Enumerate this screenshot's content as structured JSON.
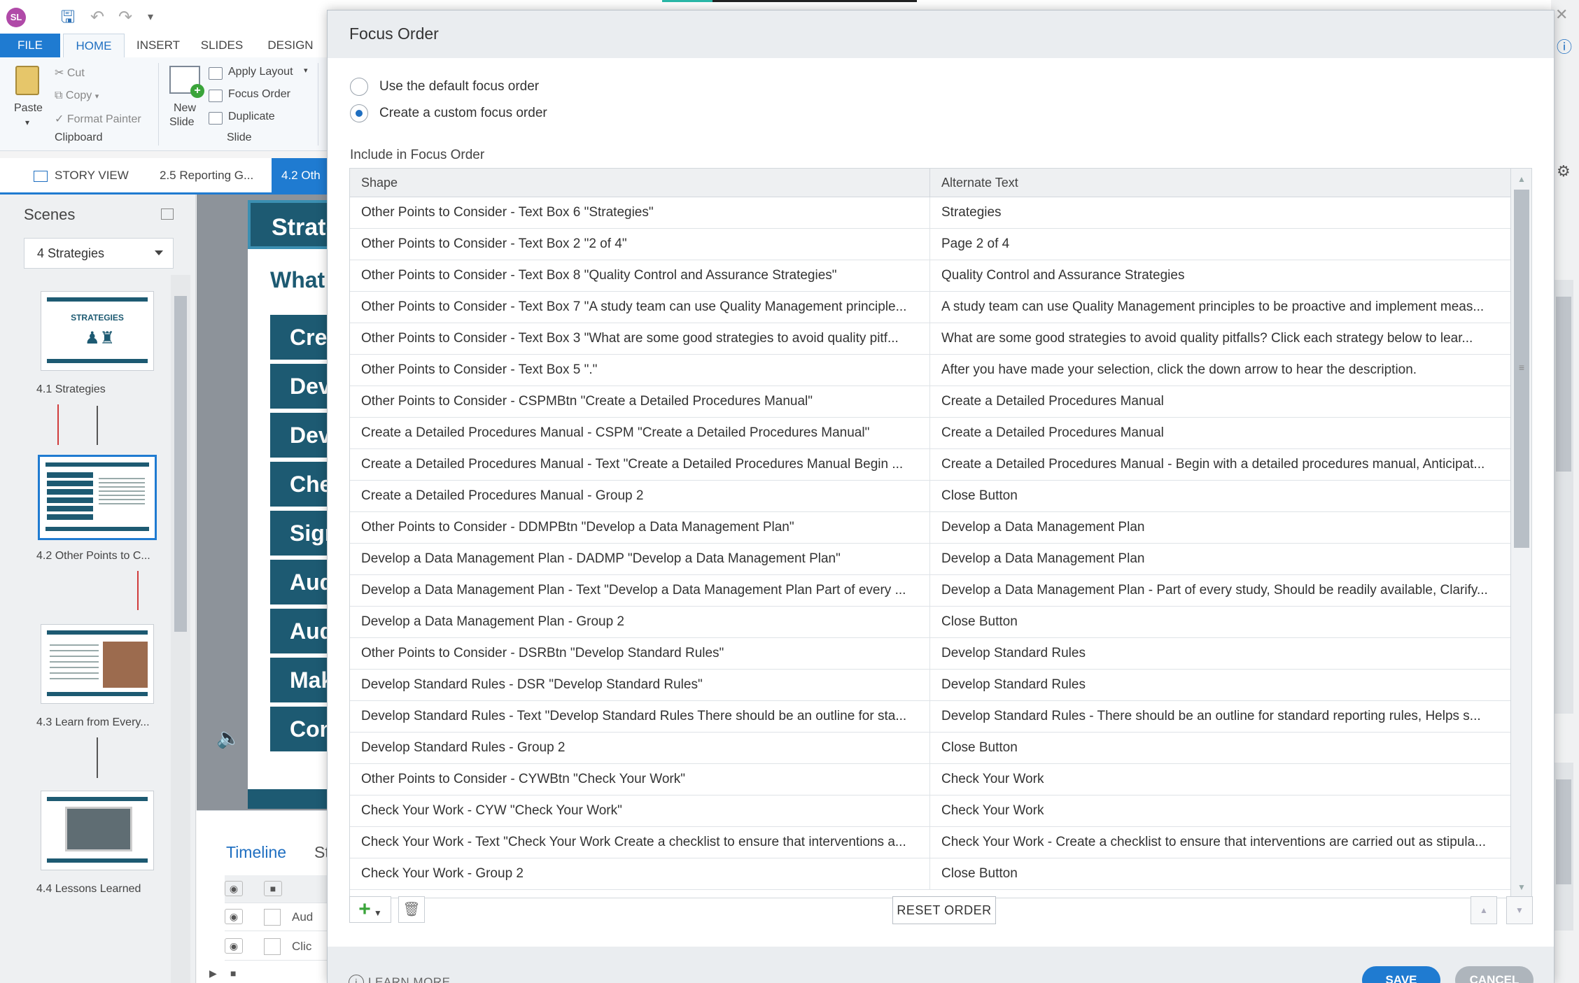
{
  "app": {
    "logo": "SL",
    "ribbon_tabs": [
      "FILE",
      "HOME",
      "INSERT",
      "SLIDES",
      "DESIGN"
    ],
    "clipboard": {
      "paste": "Paste",
      "cut": "Cut",
      "copy": "Copy",
      "format_painter": "Format Painter",
      "group": "Clipboard"
    },
    "slide_group": {
      "new_slide": "New",
      "new_slide2": "Slide",
      "apply_layout": "Apply Layout",
      "focus_order": "Focus Order",
      "duplicate": "Duplicate",
      "group": "Slide"
    },
    "view_tabs": {
      "story_view": "STORY VIEW",
      "tab2": "2.5 Reporting G...",
      "tab3": "4.2 Oth"
    }
  },
  "scenes": {
    "title": "Scenes",
    "dropdown": "4 Strategies",
    "thumbs": [
      {
        "label": "4.1 Strategies",
        "text": "STRATEGIES"
      },
      {
        "label": "4.2 Other Points to C..."
      },
      {
        "label": "4.3 Learn from Every..."
      },
      {
        "label": "4.4 Lessons Learned"
      }
    ]
  },
  "slide": {
    "title": "Strate",
    "question": "What",
    "buttons": [
      "Crea",
      "Dev",
      "Dev",
      "Che",
      "Sign",
      "Aud",
      "Aud",
      "Mak",
      "Con"
    ]
  },
  "timeline": {
    "tab": "Timeline",
    "tab2": "St",
    "rows": [
      "Aud",
      "Clic"
    ]
  },
  "dialog": {
    "title": "Focus Order",
    "radio_default": "Use the default focus order",
    "radio_custom": "Create a custom focus order",
    "selected": "custom",
    "include_label": "Include in Focus Order",
    "columns": [
      "Shape",
      "Alternate Text"
    ],
    "rows": [
      [
        "Other Points to Consider - Text Box 6 \"Strategies\"",
        "Strategies"
      ],
      [
        "Other Points to Consider - Text Box 2 \"2 of 4\"",
        "Page 2 of 4"
      ],
      [
        "Other Points to Consider - Text Box 8 \"Quality Control and Assurance Strategies\"",
        "Quality Control and Assurance Strategies"
      ],
      [
        "Other Points to Consider - Text Box 7 \"A study team can use Quality Management principle...",
        "A study team can use Quality Management principles to be proactive and implement meas..."
      ],
      [
        "Other Points to Consider - Text Box 3 \"What are some good strategies to avoid quality pitf...",
        "What are some good strategies to avoid quality pitfalls? Click each strategy below to lear..."
      ],
      [
        "Other Points to Consider - Text Box 5 \".\"",
        "After you have made your selection, click the down arrow to hear the description."
      ],
      [
        "Other Points to Consider - CSPMBtn \"Create a Detailed Procedures Manual\"",
        "Create a Detailed Procedures Manual"
      ],
      [
        "Create a Detailed Procedures Manual - CSPM \"Create a Detailed Procedures Manual\"",
        "Create a Detailed Procedures Manual"
      ],
      [
        "Create a Detailed Procedures Manual - Text \"Create a Detailed Procedures Manual Begin ...",
        "Create a Detailed Procedures Manual - Begin with a detailed procedures manual, Anticipat..."
      ],
      [
        "Create a Detailed Procedures Manual - Group  2",
        "Close Button"
      ],
      [
        "Other Points to Consider - DDMPBtn \"Develop a Data Management Plan\"",
        "Develop a Data Management Plan"
      ],
      [
        "Develop a Data Management Plan - DADMP \"Develop a Data Management Plan\"",
        "Develop a Data Management Plan"
      ],
      [
        "Develop a Data Management Plan - Text \"Develop a Data Management Plan Part of every ...",
        "Develop a Data Management Plan - Part of every study, Should be readily available, Clarify..."
      ],
      [
        "Develop a Data Management Plan - Group  2",
        "Close Button"
      ],
      [
        "Other Points to Consider - DSRBtn \"Develop Standard Rules\"",
        "Develop Standard Rules"
      ],
      [
        "Develop Standard Rules - DSR \"Develop Standard Rules\"",
        "Develop Standard Rules"
      ],
      [
        "Develop Standard Rules - Text \"Develop Standard Rules There should be an outline for sta...",
        "Develop Standard Rules - There should be an outline for standard reporting rules, Helps s..."
      ],
      [
        "Develop Standard Rules - Group  2",
        "Close Button"
      ],
      [
        "Other Points to Consider - CYWBtn \"Check Your Work\"",
        "Check Your Work"
      ],
      [
        "Check Your Work - CYW \"Check Your Work\"",
        "Check Your Work"
      ],
      [
        "Check Your Work - Text \"Check Your Work Create a checklist to ensure that interventions a...",
        "Check Your Work - Create a checklist to ensure that interventions are carried out as stipula..."
      ],
      [
        "Check Your Work - Group  2",
        "Close Button"
      ]
    ],
    "reset_order": "RESET ORDER",
    "learn_more": "LEARN MORE",
    "save": "SAVE",
    "cancel": "CANCEL"
  },
  "colors": {
    "accent": "#1f7bd1",
    "slide_teal": "#1d5a72",
    "add_green": "#3aa43a"
  }
}
